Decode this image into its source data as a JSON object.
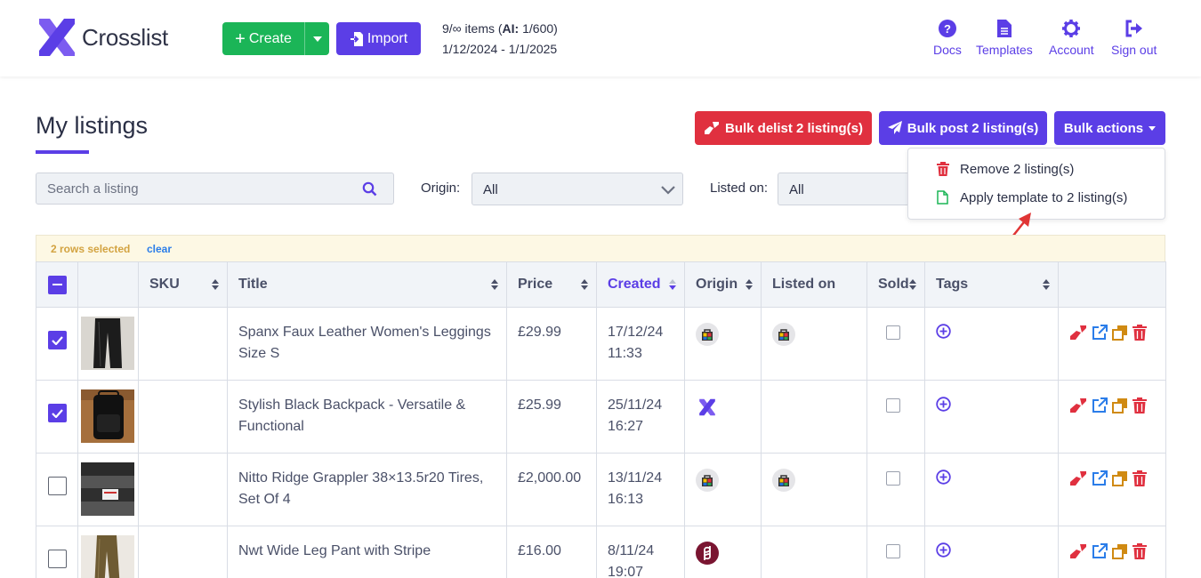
{
  "app": {
    "name": "Crosslist"
  },
  "header": {
    "create_label": "Create",
    "import_label": "Import",
    "items_prefix": "9/∞ items (",
    "ai_label": "AI:",
    "ai_value": " 1/600)",
    "period": "1/12/2024 - 1/1/2025",
    "nav": [
      {
        "label": "Docs",
        "icon": "question-circle-icon"
      },
      {
        "label": "Templates",
        "icon": "document-icon"
      },
      {
        "label": "Account",
        "icon": "gear-icon"
      },
      {
        "label": "Sign out",
        "icon": "sign-out-icon"
      }
    ]
  },
  "page": {
    "title": "My listings",
    "bulk_delist_label": "Bulk delist 2 listing(s)",
    "bulk_post_label": "Bulk post 2 listing(s)",
    "bulk_actions_label": "Bulk actions"
  },
  "bulk_menu": {
    "items": [
      {
        "label": "Remove 2 listing(s)",
        "icon": "trash-icon"
      },
      {
        "label": "Apply template to 2 listing(s)",
        "icon": "file-icon"
      }
    ]
  },
  "filters": {
    "search_placeholder": "Search a listing",
    "origin_label": "Origin:",
    "origin_value": "All",
    "listed_on_label": "Listed on:",
    "listed_on_value": "All"
  },
  "selection": {
    "count_text": "2 rows selected",
    "clear_label": "clear"
  },
  "table": {
    "columns": [
      "SKU",
      "Title",
      "Price",
      "Created",
      "Origin",
      "Listed on",
      "Sold",
      "Tags"
    ],
    "sorted_column": "Created",
    "rows": [
      {
        "checked": true,
        "sku": "",
        "title": "Spanx Faux Leather Women's Leggings Size S",
        "price": "£29.99",
        "date": "17/12/24",
        "time": "11:33",
        "origin": "bag",
        "listed_on": "bag"
      },
      {
        "checked": true,
        "sku": "",
        "title": "Stylish Black Backpack - Versatile & Functional",
        "price": "£25.99",
        "date": "25/11/24",
        "time": "16:27",
        "origin": "crosslist",
        "listed_on": ""
      },
      {
        "checked": false,
        "sku": "",
        "title": "Nitto Ridge Grappler 38×13.5r20 Tires, Set Of 4",
        "price": "£2,000.00",
        "date": "13/11/24",
        "time": "16:13",
        "origin": "bag",
        "listed_on": "bag"
      },
      {
        "checked": false,
        "sku": "",
        "title": "Nwt Wide Leg Pant with Stripe",
        "price": "£16.00",
        "date": "8/11/24",
        "time": "19:07",
        "origin": "poshmark",
        "listed_on": ""
      }
    ]
  },
  "colors": {
    "primary": "#5b3ee6",
    "success": "#1bb557",
    "danger": "#e0303f",
    "warning_bg": "#fdf8e4"
  }
}
